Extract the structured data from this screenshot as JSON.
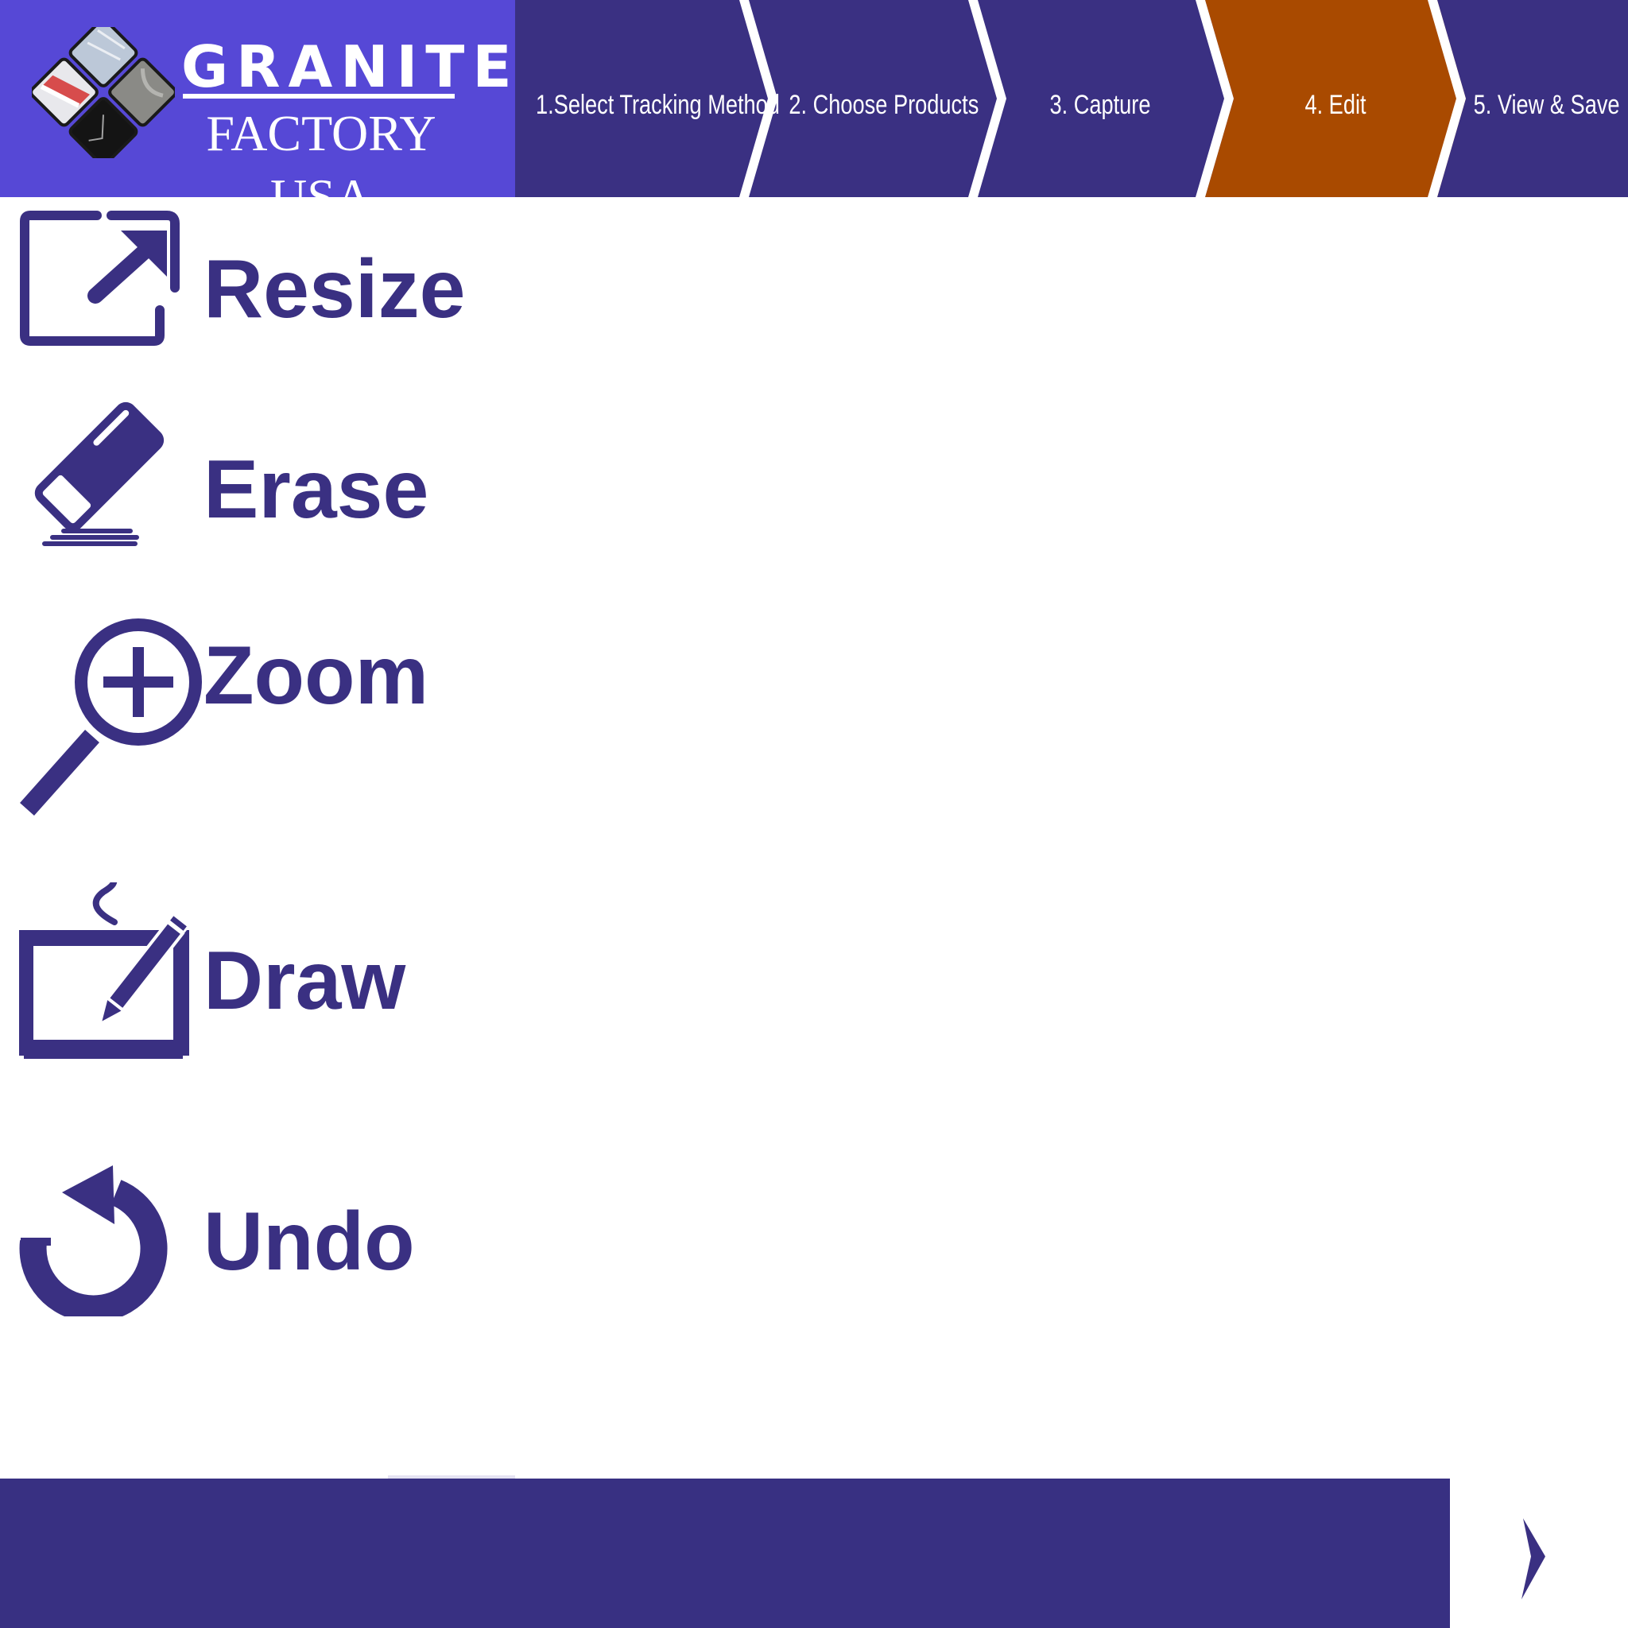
{
  "brand": {
    "line1": "GRANITE",
    "line2": "FACTORY USA"
  },
  "steps": [
    {
      "label": "1.Select Tracking Method",
      "active": false
    },
    {
      "label": "2. Choose Products",
      "active": false
    },
    {
      "label": "3. Capture",
      "active": false
    },
    {
      "label": "4. Edit",
      "active": true
    },
    {
      "label": "5. View & Save",
      "active": false
    }
  ],
  "tools": [
    {
      "label": "Resize",
      "icon": "resize-icon"
    },
    {
      "label": "Erase",
      "icon": "eraser-icon"
    },
    {
      "label": "Zoom",
      "icon": "zoom-in-icon"
    },
    {
      "label": "Draw",
      "icon": "draw-tablet-icon"
    },
    {
      "label": "Undo",
      "icon": "undo-icon"
    }
  ],
  "footer": {
    "next_icon": "chevron-right-icon"
  },
  "colors": {
    "brand_purple": "#5648d6",
    "nav_purple": "#3a3082",
    "active_step": "#a94a00",
    "tool_color": "#3a3082",
    "background": "#ffffff"
  }
}
